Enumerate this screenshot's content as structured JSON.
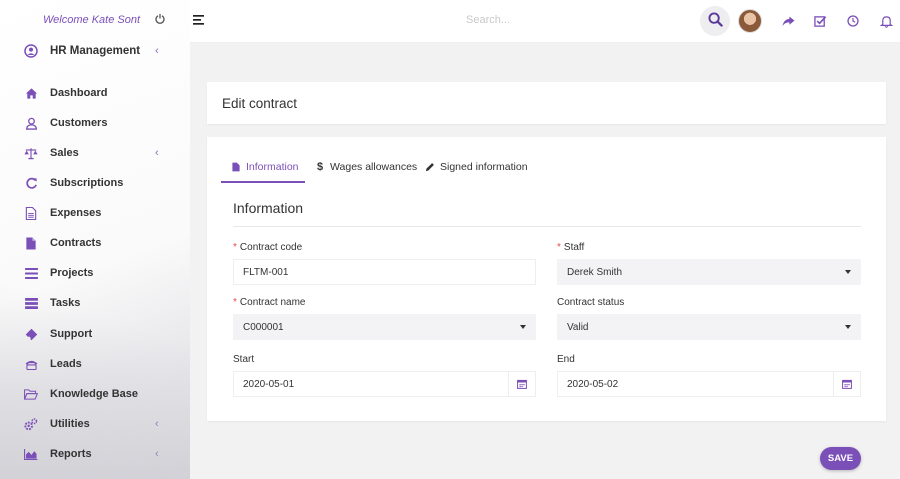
{
  "sidebar": {
    "welcome": "Welcome Kate Sont",
    "module": "HR Management",
    "items": [
      {
        "label": "Dashboard",
        "icon": "home-icon"
      },
      {
        "label": "Customers",
        "icon": "user-icon"
      },
      {
        "label": "Sales",
        "icon": "balance-scale-icon"
      },
      {
        "label": "Subscriptions",
        "icon": "refresh-icon"
      },
      {
        "label": "Expenses",
        "icon": "file-text-icon"
      },
      {
        "label": "Contracts",
        "icon": "file-icon"
      },
      {
        "label": "Projects",
        "icon": "bars-icon"
      },
      {
        "label": "Tasks",
        "icon": "tasks-icon"
      },
      {
        "label": "Support",
        "icon": "ticket-icon"
      },
      {
        "label": "Leads",
        "icon": "phone-icon"
      },
      {
        "label": "Knowledge Base",
        "icon": "folder-open-icon"
      },
      {
        "label": "Utilities",
        "icon": "cogs-icon"
      },
      {
        "label": "Reports",
        "icon": "area-chart-icon"
      }
    ]
  },
  "topbar": {
    "search_placeholder": "Search..."
  },
  "page": {
    "title": "Edit contract",
    "tabs": [
      {
        "label": "Information",
        "icon": "file-icon"
      },
      {
        "label": "Wages allowances",
        "icon": "dollar-icon"
      },
      {
        "label": "Signed information",
        "icon": "pencil-icon"
      }
    ],
    "section_title": "Information",
    "fields": {
      "contract_code": {
        "label": "Contract code",
        "value": "FLTM-001"
      },
      "staff": {
        "label": "Staff",
        "value": "Derek Smith"
      },
      "contract_name": {
        "label": "Contract name",
        "value": "C000001"
      },
      "contract_status": {
        "label": "Contract status",
        "value": "Valid"
      },
      "start": {
        "label": "Start",
        "value": "2020-05-01"
      },
      "end": {
        "label": "End",
        "value": "2020-05-02"
      }
    },
    "save_label": "SAVE"
  },
  "colors": {
    "accent": "#7b4fb8",
    "required": "#e04e4e"
  }
}
